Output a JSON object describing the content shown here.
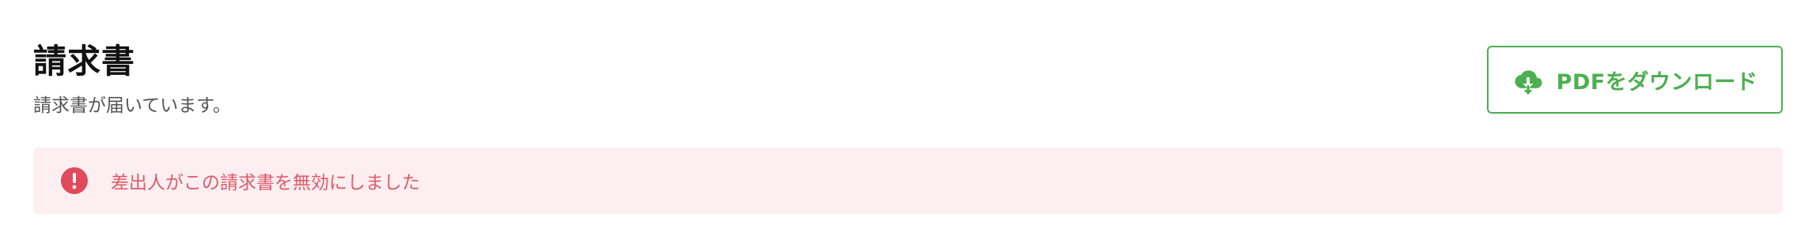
{
  "header": {
    "title": "請求書",
    "subtitle": "請求書が届いています。",
    "download_button": {
      "label": "PDFをダウンロード",
      "icon": "cloud-download-icon"
    }
  },
  "alert": {
    "icon": "error-circle-icon",
    "message": "差出人がこの請求書を無効にしました"
  },
  "colors": {
    "accent_green": "#4caf50",
    "alert_background": "#fdeff1",
    "alert_text": "#e05a6a",
    "alert_icon": "#e04a5c"
  }
}
